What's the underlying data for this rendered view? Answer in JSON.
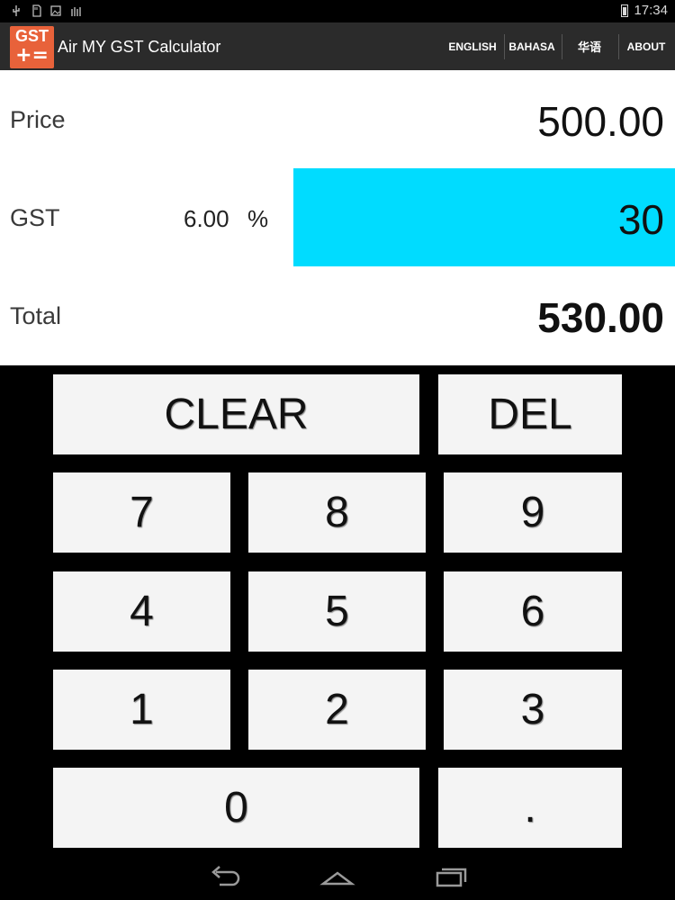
{
  "status_bar": {
    "time": "17:34",
    "icons": [
      "usb-icon",
      "sd-card-icon",
      "image-icon",
      "signal-bars-icon",
      "battery-icon"
    ]
  },
  "app_bar": {
    "logo_text": "GST",
    "logo_ops": "+=",
    "title": "Air MY GST Calculator",
    "nav": [
      "ENGLISH",
      "BAHASA",
      "华语",
      "ABOUT"
    ]
  },
  "calculator": {
    "price_label": "Price",
    "price_value": "500.00",
    "gst_label": "GST",
    "gst_rate": "6.00",
    "gst_percent_sign": "%",
    "gst_value": "30",
    "total_label": "Total",
    "total_value": "530.00",
    "gst_field_color": "#00dcff"
  },
  "keypad": {
    "clear": "CLEAR",
    "del": "DEL",
    "k7": "7",
    "k8": "8",
    "k9": "9",
    "k4": "4",
    "k5": "5",
    "k6": "6",
    "k1": "1",
    "k2": "2",
    "k3": "3",
    "k0": "0",
    "dot": "."
  },
  "system_nav": [
    "back-icon",
    "home-icon",
    "recent-apps-icon"
  ]
}
